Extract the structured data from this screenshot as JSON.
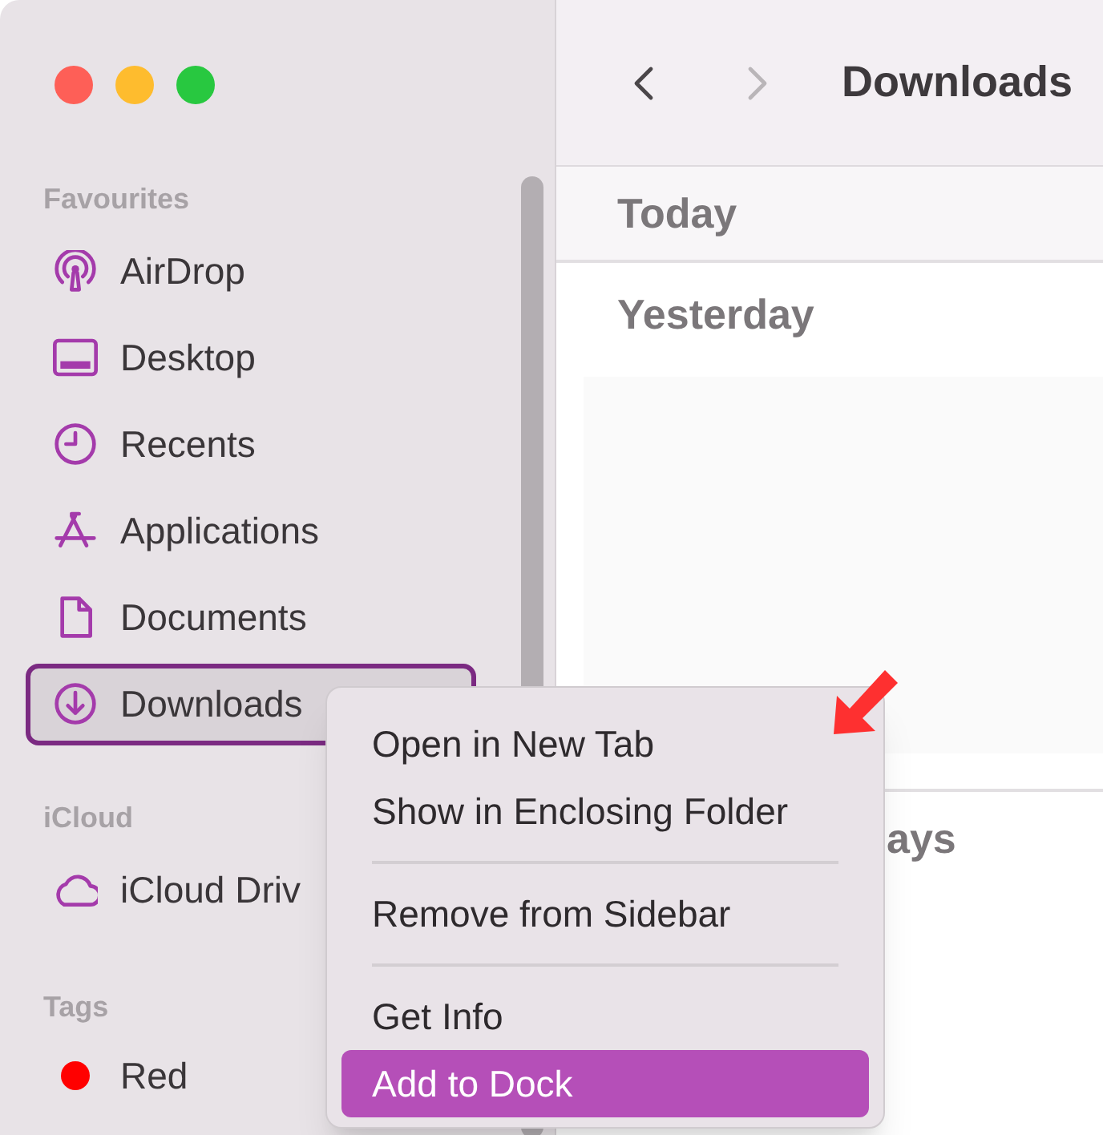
{
  "window": {
    "title": "Downloads"
  },
  "toolbar": {
    "back": {
      "disabled": false
    },
    "forward": {
      "disabled": true
    }
  },
  "sidebar": {
    "sections": [
      {
        "heading": "Favourites",
        "items": [
          {
            "label": "AirDrop",
            "selected": false
          },
          {
            "label": "Desktop",
            "selected": false
          },
          {
            "label": "Recents",
            "selected": false
          },
          {
            "label": "Applications",
            "selected": false
          },
          {
            "label": "Documents",
            "selected": false
          },
          {
            "label": "Downloads",
            "selected": true
          }
        ]
      },
      {
        "heading": "iCloud",
        "items": [
          {
            "label": "iCloud Driv",
            "selected": false
          }
        ]
      },
      {
        "heading": "Tags",
        "items": [
          {
            "label": "Red",
            "selected": false,
            "kind": "tag",
            "color": "#ff0000"
          }
        ]
      }
    ]
  },
  "groups": [
    {
      "label": "Today"
    },
    {
      "label": "Yesterday"
    },
    {
      "label": "ays"
    }
  ],
  "context_menu": {
    "groups": [
      [
        {
          "label": "Open in New Tab",
          "selected": false
        },
        {
          "label": "Show in Enclosing Folder",
          "selected": false
        }
      ],
      [
        {
          "label": "Remove from Sidebar",
          "selected": false
        }
      ],
      [
        {
          "label": "Get Info",
          "selected": false
        },
        {
          "label": "Add to Dock",
          "selected": true
        }
      ]
    ]
  }
}
